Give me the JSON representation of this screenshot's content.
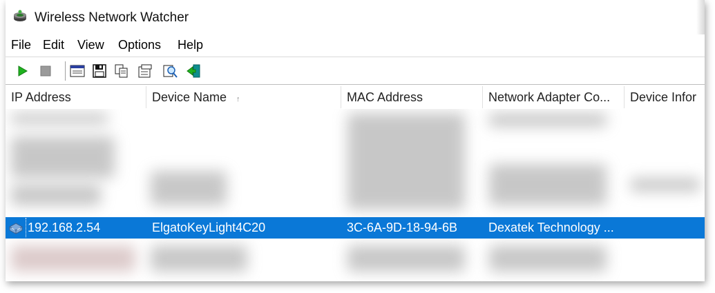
{
  "window": {
    "title": "Wireless Network Watcher"
  },
  "menu": {
    "items": [
      "File",
      "Edit",
      "View",
      "Options",
      "Help"
    ]
  },
  "toolbar": {
    "buttons": [
      "start-icon",
      "stop-icon",
      "html-report-icon",
      "save-icon",
      "copy-icon",
      "properties-icon",
      "find-icon",
      "exit-icon"
    ]
  },
  "table": {
    "columns": [
      "IP Address",
      "Device Name",
      "MAC Address",
      "Network Adapter Co...",
      "Device Infor"
    ],
    "sort_indicator": "↑",
    "selected_row": {
      "ip": "192.168.2.54",
      "device_name": "ElgatoKeyLight4C20",
      "mac": "3C-6A-9D-18-94-6B",
      "adapter_company": "Dexatek Technology ...",
      "device_info": ""
    }
  },
  "colors": {
    "selection": "#0a78d7",
    "play": "#1fb21f"
  }
}
